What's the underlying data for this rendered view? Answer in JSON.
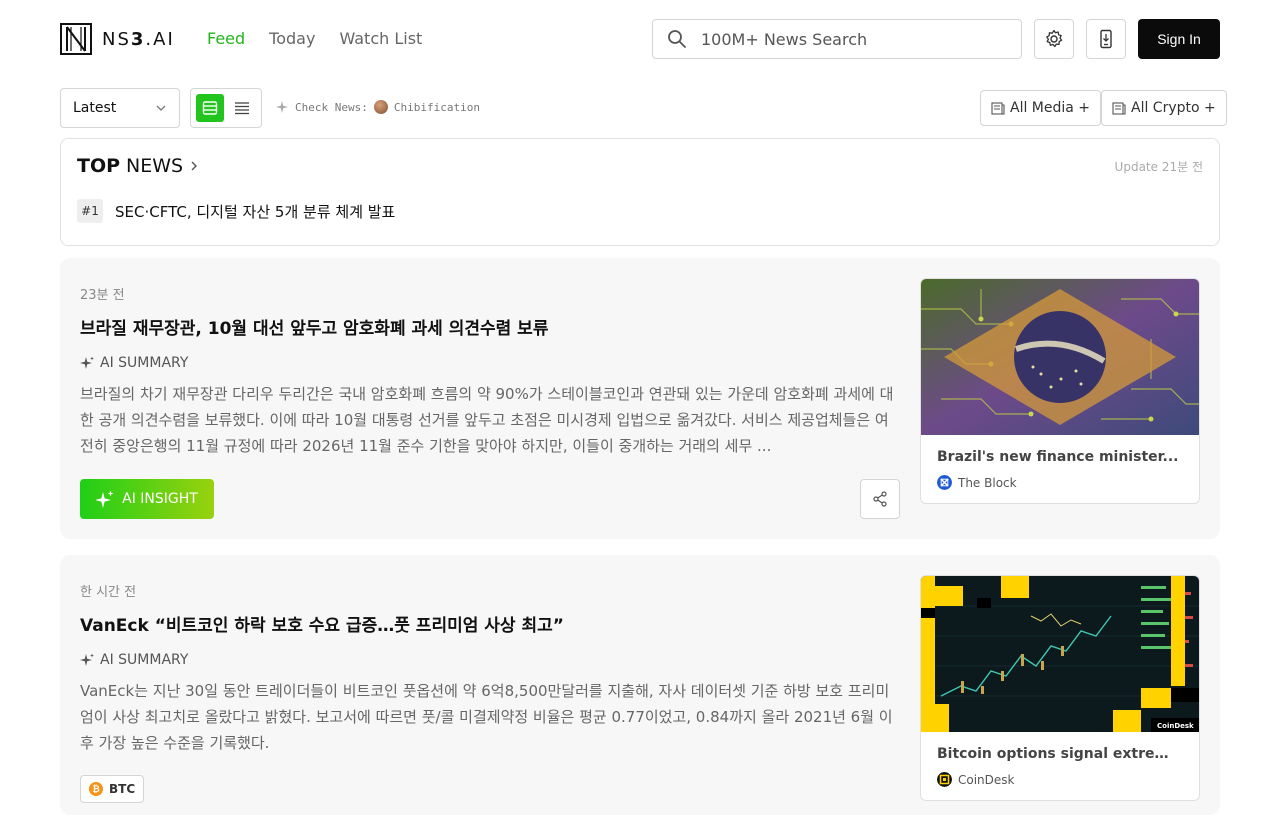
{
  "header": {
    "logo_text_a": "NS",
    "logo_text_b": "3",
    "logo_text_c": ".AI",
    "nav": [
      {
        "label": "Feed",
        "active": true
      },
      {
        "label": "Today",
        "active": false
      },
      {
        "label": "Watch List",
        "active": false
      }
    ],
    "search_placeholder": "100M+ News Search",
    "signin_label": "Sign In",
    "icons": [
      "search-icon",
      "gear-icon",
      "mobile-app-icon"
    ]
  },
  "toolbar": {
    "sort_value": "Latest",
    "check_news_label": "Check News:",
    "check_news_user": "Chibification",
    "filter_media": "All Media +",
    "filter_crypto": "All Crypto +"
  },
  "top_news": {
    "title_bold": "TOP",
    "title_rest": "NEWS",
    "update": "Update 21분 전",
    "items": [
      {
        "rank": "#1",
        "headline": "SEC·CFTC, 디지털 자산 5개 분류 체계 발표"
      }
    ]
  },
  "cards": [
    {
      "time": "23분 전",
      "title": "브라질 재무장관, 10월 대선 앞두고 암호화폐 과세 의견수렴 보류",
      "ai_label": "AI SUMMARY",
      "summary": "브라질의 차기 재무장관 다리우 두리간은 국내 암호화폐 흐름의 약 90%가 스테이블코인과 연관돼 있는 가운데 암호화폐 과세에 대한 공개 의견수렴을 보류했다. 이에 따라 10월 대통령 선거를 앞두고 초점은 미시경제 입법으로 옮겨갔다. 서비스 제공업체들은 여전히 중앙은행의 11월 규정에 따라 2026년 11월 준수 기한을 맞아야 하지만, 이들이 중개하는 거래의 세무 ...",
      "insight_label": "AI INSIGHT",
      "media_title": "Brazil's new finance minister...",
      "media_source": "The Block"
    },
    {
      "time": "한 시간 전",
      "title": "VanEck “비트코인 하락 보호 수요 급증…풋 프리미엄 사상 최고”",
      "ai_label": "AI SUMMARY",
      "summary": "VanEck는 지난 30일 동안 트레이더들이 비트코인 풋옵션에 약 6억8,500만달러를 지출해, 자사 데이터셋 기준 하방 보호 프리미엄이 사상 최고치로 올랐다고 밝혔다. 보고서에 따르면 풋/콜 미결제약정 비율은 평균 0.77이었고, 0.84까지 올라 2021년 6월 이후 가장 높은 수준을 기록했다.",
      "tag": "BTC",
      "media_title": "Bitcoin options signal extreme...",
      "media_source": "CoinDesk",
      "media_watermark": "CoinDesk"
    }
  ],
  "colors": {
    "accent_green": "#22b51c",
    "signin_bg": "#0b0b0b"
  }
}
